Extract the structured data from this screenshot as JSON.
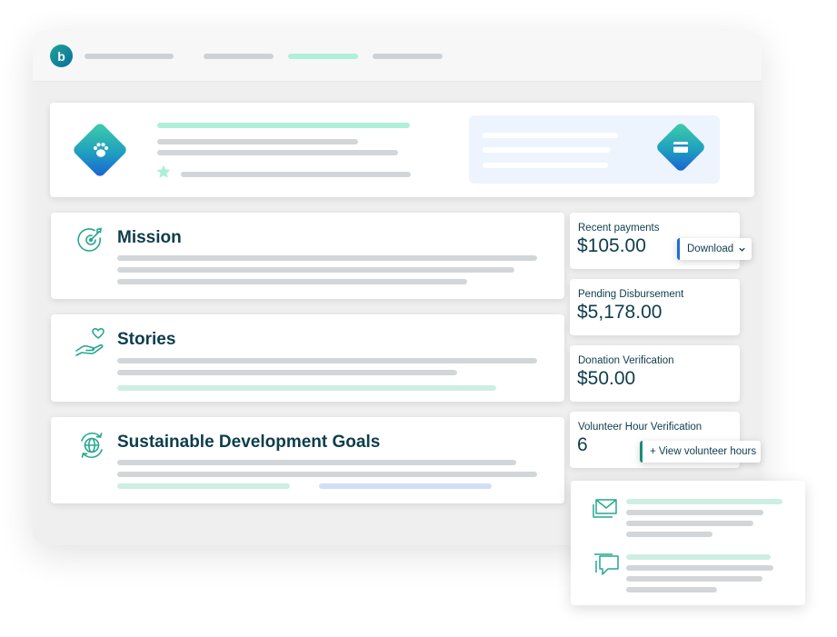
{
  "app": {
    "logo_letter": "b"
  },
  "sections": {
    "mission": "Mission",
    "stories": "Stories",
    "sdg": "Sustainable Development Goals"
  },
  "stats": {
    "recent_payments": {
      "label": "Recent payments",
      "value": "$105.00"
    },
    "pending_disbursement": {
      "label": "Pending Disbursement",
      "value": "$5,178.00"
    },
    "donation_verification": {
      "label": "Donation Verification",
      "value": "$50.00"
    },
    "volunteer_hour_verification": {
      "label": "Volunteer Hour Verification",
      "value": "6"
    }
  },
  "buttons": {
    "download": "Download",
    "view_volunteer_hours": "+ View volunteer hours"
  },
  "colors": {
    "accent_teal": "#2bb597",
    "accent_blue": "#1a5fd4",
    "text_dark": "#0e3d4c",
    "placeholder_gray": "#d3d6d8",
    "placeholder_mint": "#aaf0d8"
  },
  "icons": [
    "logo",
    "paw-icon",
    "star-icon",
    "card-icon",
    "target-icon",
    "hand-heart-icon",
    "globe-icon",
    "chevron-down-icon",
    "envelope-icon",
    "chat-icon"
  ]
}
